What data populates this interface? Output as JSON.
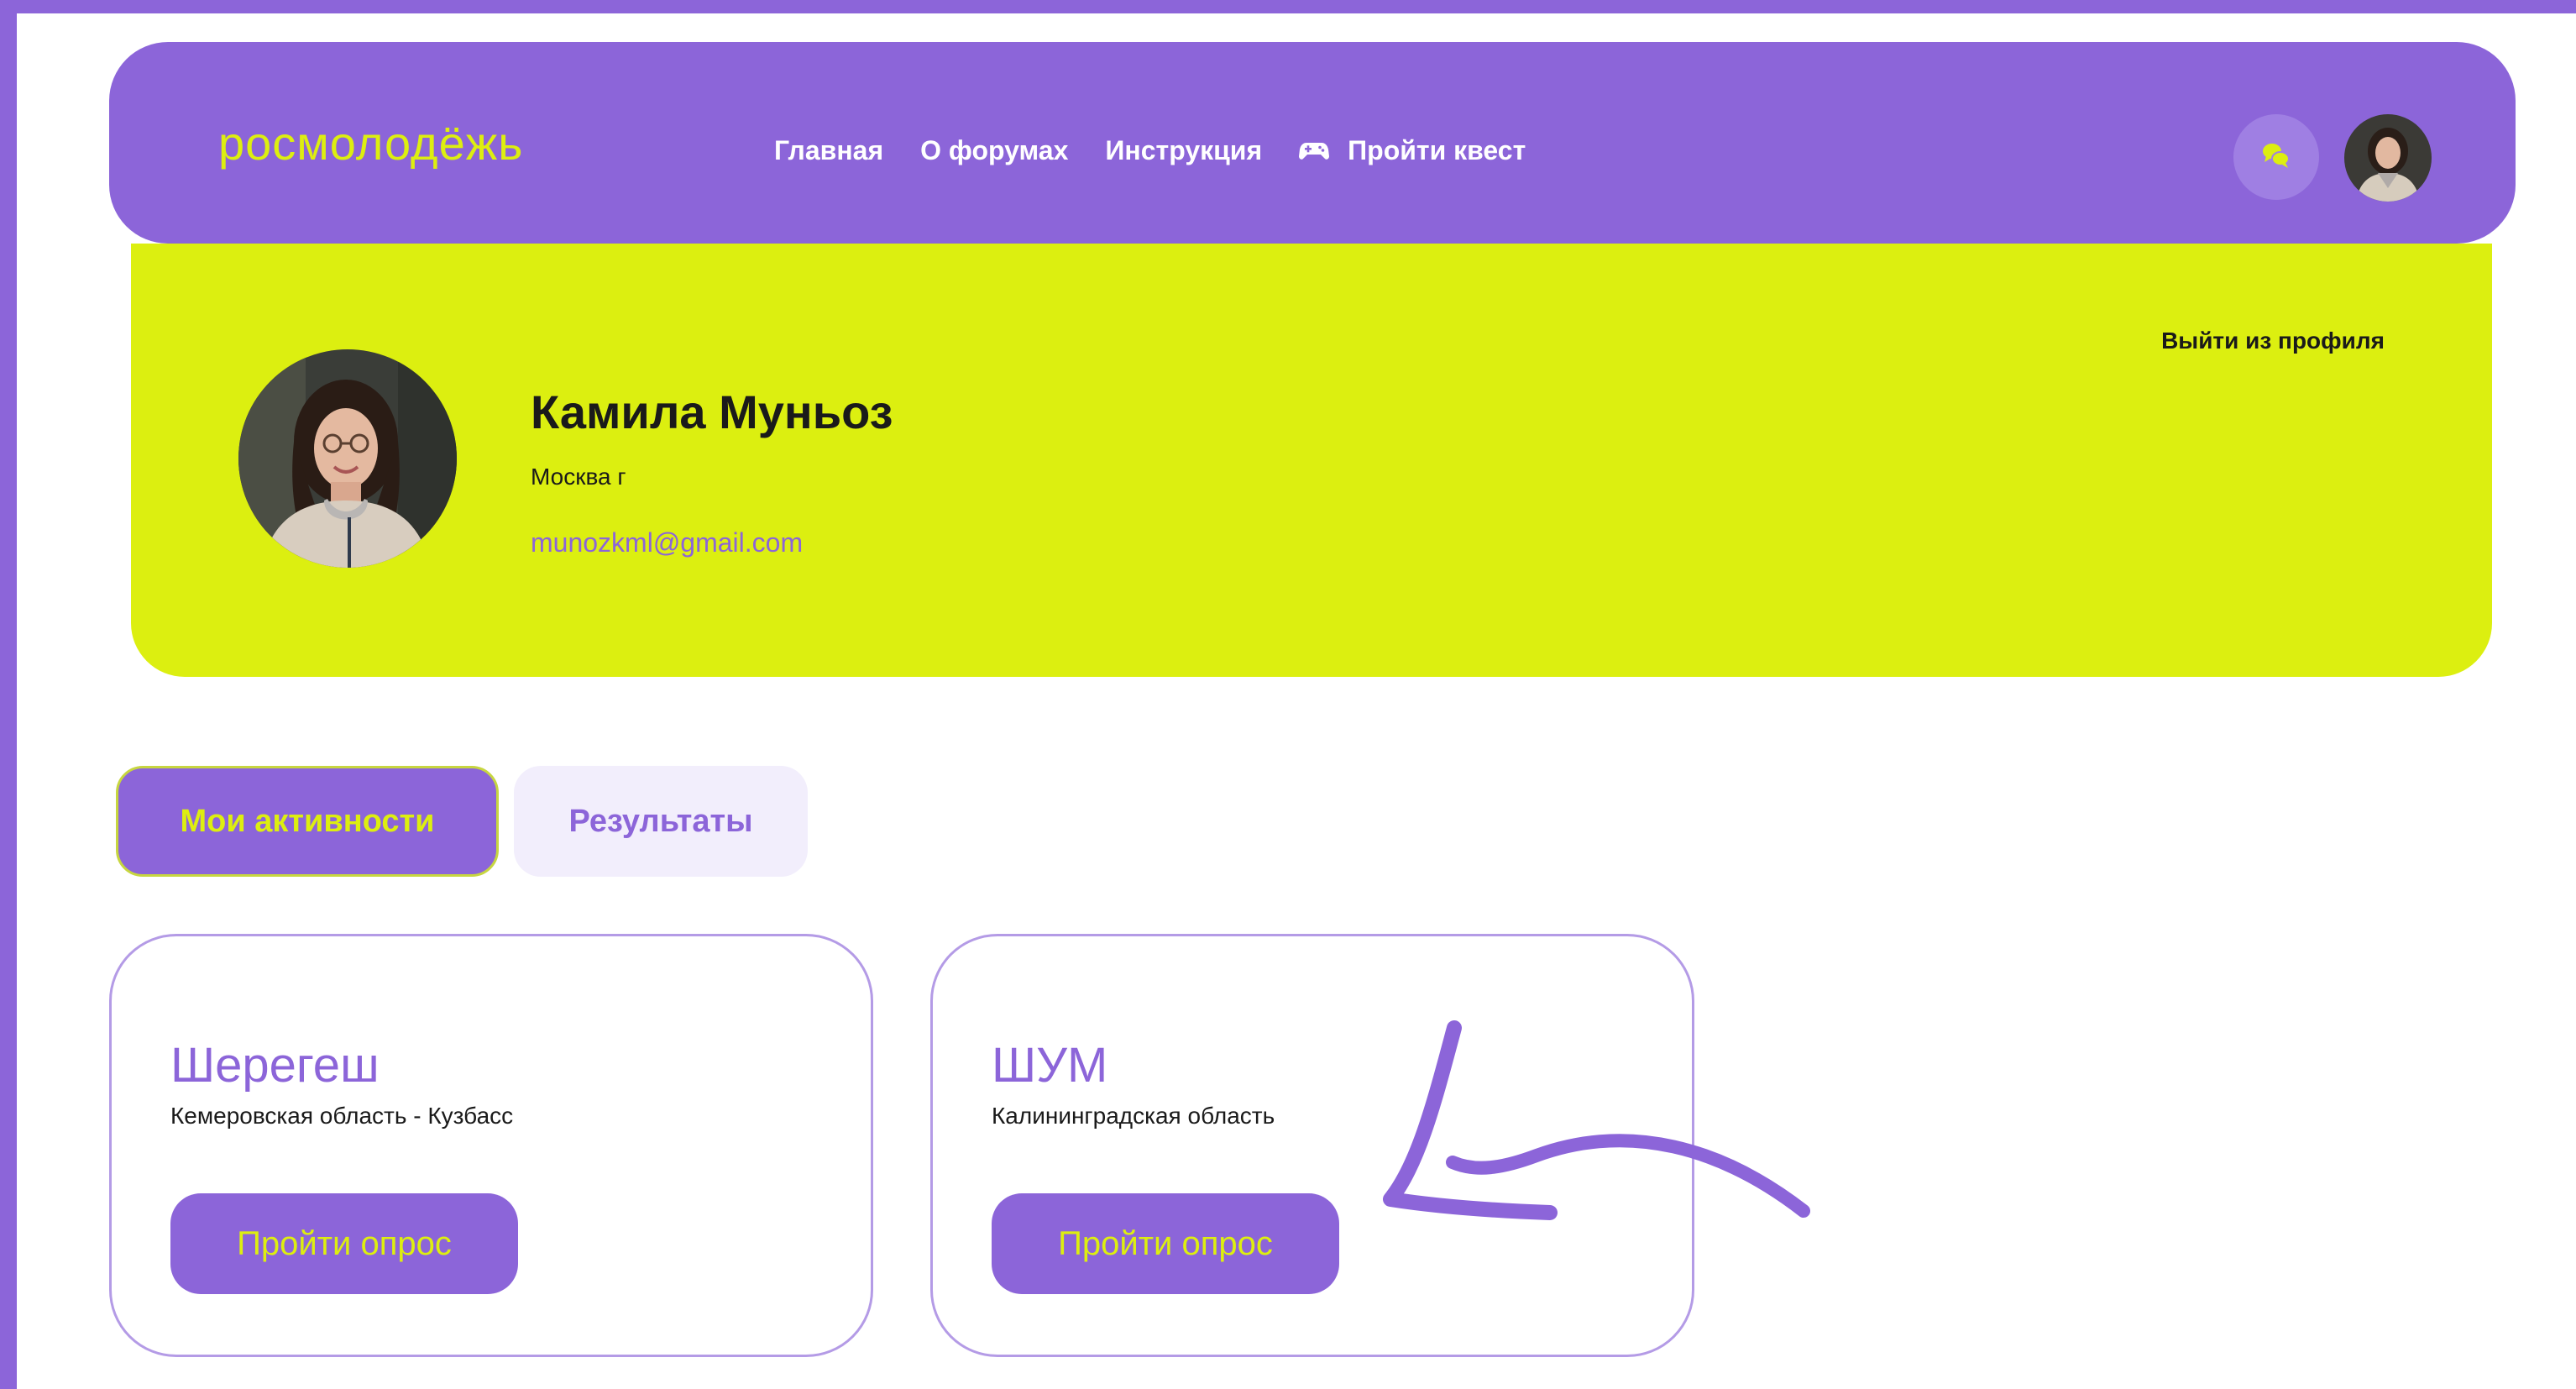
{
  "header": {
    "logo": "росмолодёжь",
    "nav": [
      {
        "label": "Главная"
      },
      {
        "label": "О форумах"
      },
      {
        "label": "Инструкция"
      },
      {
        "label": "Пройти квест",
        "icon": "gamepad-icon"
      }
    ],
    "chat_icon": "chat-icon",
    "avatar_icon": "user-avatar"
  },
  "profile": {
    "name": "Камила Муньоз",
    "city": "Москва г",
    "email": "munozkml@gmail.com",
    "logout_label": "Выйти из профиля"
  },
  "tabs": [
    {
      "label": "Мои активности",
      "active": true
    },
    {
      "label": "Результаты",
      "active": false
    }
  ],
  "activities": [
    {
      "title": "Шерегеш",
      "region": "Кемеровская область - Кузбасс",
      "button_label": "Пройти опрос"
    },
    {
      "title": "ШУМ",
      "region": "Калининградская область",
      "button_label": "Пройти опрос"
    }
  ],
  "colors": {
    "purple": "#8c65d9",
    "lime": "#dcef10",
    "light_lavender": "#f2eefc",
    "card_border": "#b49be6"
  }
}
